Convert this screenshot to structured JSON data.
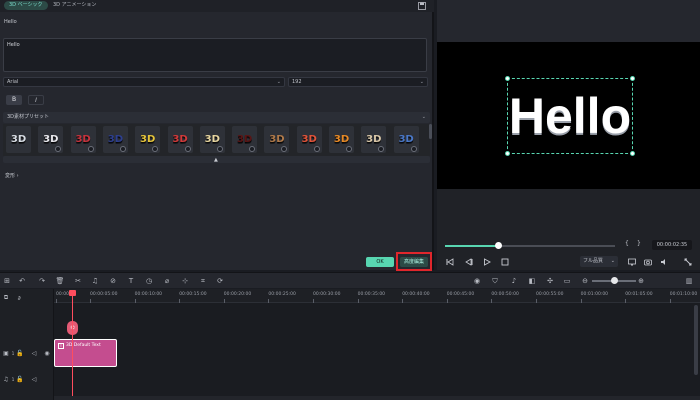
{
  "tabs": [
    {
      "label": "3D ベーシック",
      "active": true
    },
    {
      "label": "3D アニメーション",
      "active": false
    }
  ],
  "text_section_label": "Hello",
  "text_value": "Hello",
  "font_select": "Arial",
  "size_select": "192",
  "style_buttons": [
    "B",
    "I"
  ],
  "preset_header": "3D素材プリセット",
  "preset_tile_label": "3D",
  "transform_label": "変形",
  "ok_label": "OK",
  "advanced_label": "高度編集",
  "preview_text": "Hello",
  "timecode": "00:00:02:35",
  "bracket_in": "{",
  "bracket_out": "}",
  "quality_select": "フル品質",
  "playback_progress": 0.31,
  "ruler_labels": [
    "00:00",
    "00:00:05:00",
    "00:00:10:00",
    "00:00:15:00",
    "00:00:20:00",
    "00:00:25:00",
    "00:00:30:00",
    "00:00:35:00",
    "00:00:40:00",
    "00:00:45:00",
    "00:00:50:00",
    "00:00:55:00",
    "00:01:00:00",
    "00:01:05:00",
    "00:01:10:00"
  ],
  "clip_title": "3D Default Text",
  "track_video_number": "1",
  "track_audio_number": "1",
  "colors": {
    "accent": "#58d6b1",
    "clip": "#c44d8f",
    "playhead": "#ff4d5e",
    "highlight": "#e0262c"
  },
  "presets": [
    {
      "style": "silver",
      "color": "#d8dde4"
    },
    {
      "style": "white",
      "color": "#e9e9ee"
    },
    {
      "style": "red-chrome",
      "color": "#c7333d"
    },
    {
      "style": "blue",
      "color": "#2d3f8f"
    },
    {
      "style": "gold",
      "color": "#e5c43b"
    },
    {
      "style": "red-gloss",
      "color": "#d23a3a"
    },
    {
      "style": "cream-gold",
      "color": "#e8d6a0"
    },
    {
      "style": "dark-red",
      "color": "#5a1414"
    },
    {
      "style": "bronze",
      "color": "#b07a4a"
    },
    {
      "style": "red-orange",
      "color": "#e2543a"
    },
    {
      "style": "orange",
      "color": "#e88a26"
    },
    {
      "style": "beige",
      "color": "#d9c7a8"
    },
    {
      "style": "blue-steel",
      "color": "#4a78c8"
    }
  ]
}
